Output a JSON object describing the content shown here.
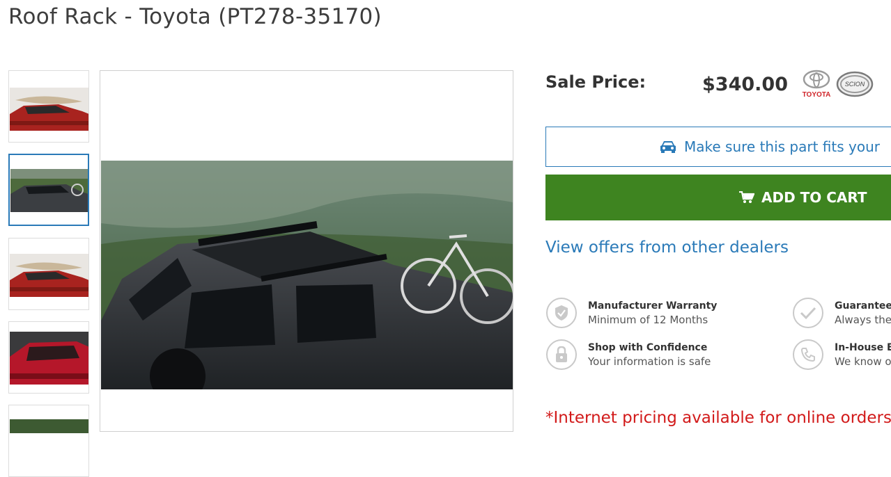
{
  "product": {
    "title": "Roof Rack - Toyota (PT278-35170)"
  },
  "pricing": {
    "label": "Sale Price:",
    "value": "$340.00"
  },
  "brands": [
    {
      "name": "TOYOTA",
      "icon": "toyota-logo"
    },
    {
      "name": "SCION",
      "icon": "scion-logo"
    }
  ],
  "actions": {
    "fits_label": "Make sure this part fits your",
    "fits_icon": "car-icon",
    "cart_label": "ADD TO CART",
    "cart_icon": "cart-icon",
    "offers_link": "View offers from other dealers"
  },
  "features": [
    {
      "title": "Manufacturer Warranty",
      "subtitle": "Minimum of 12 Months",
      "icon": "shield-check-icon"
    },
    {
      "title": "Guaranteed",
      "subtitle": "Always the",
      "icon": "checkmark-icon"
    },
    {
      "title": "Shop with Confidence",
      "subtitle": "Your information is safe",
      "icon": "lock-icon"
    },
    {
      "title": "In-House Ex",
      "subtitle": "We know o",
      "icon": "phone-icon"
    }
  ],
  "notice": "*Internet pricing available for online orders",
  "gallery": {
    "selected_index": 1,
    "thumbnails": [
      "kayak-on-red-truck",
      "black-truck-with-bikes",
      "kayak-on-red-truck",
      "red-truck-roof-rack",
      "forest-scene"
    ]
  },
  "colors": {
    "link_blue": "#2a7ab8",
    "cart_green": "#3e8420",
    "notice_red": "#d21a1a"
  }
}
